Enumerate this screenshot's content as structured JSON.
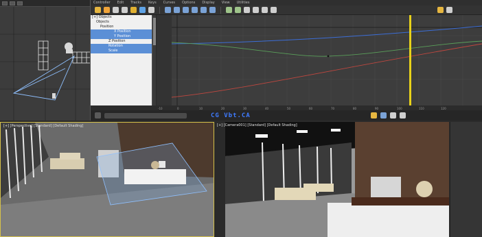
{
  "curve_editor": {
    "menu": [
      "Controller",
      "Edit",
      "Tracks",
      "Keys",
      "Curves",
      "Options",
      "Display",
      "View",
      "Utilities"
    ],
    "tree": [
      {
        "label": "[+] Objects",
        "indent": 0,
        "selected": false
      },
      {
        "label": "Objects",
        "indent": 1,
        "selected": false
      },
      {
        "label": "Position",
        "indent": 2,
        "selected": false
      },
      {
        "label": "X Position",
        "indent": 3,
        "selected": true
      },
      {
        "label": "Y Position",
        "indent": 3,
        "selected": true
      },
      {
        "label": "Z Position",
        "indent": 3,
        "selected": false
      },
      {
        "label": "Rotation",
        "indent": 2,
        "selected": true
      },
      {
        "label": "Scale",
        "indent": 2,
        "selected": true
      }
    ],
    "frame_ticks": [
      "-10",
      "0",
      "10",
      "20",
      "30",
      "40",
      "50",
      "60",
      "70",
      "80",
      "90",
      "100",
      "110",
      "120"
    ],
    "value_ticks": [
      "0",
      "-100",
      "-200"
    ]
  },
  "viewports": {
    "perspective_label": "[+] [Perspective] [Standard] [Default Shading]",
    "camera_label": "[+] [Camera001] [Standard] [Default Shading]"
  },
  "watermark": "CG Vbt.CA"
}
